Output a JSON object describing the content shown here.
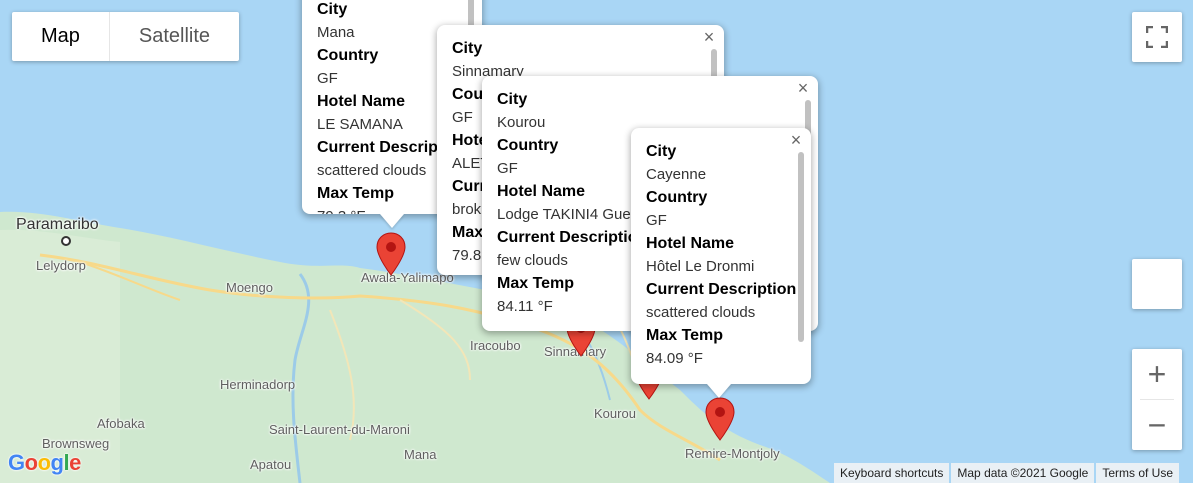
{
  "map_type": {
    "map_label": "Map",
    "satellite_label": "Satellite",
    "selected": "Map"
  },
  "places": [
    {
      "name": "Paramaribo",
      "big": true
    },
    {
      "name": "Lelydorp"
    },
    {
      "name": "Moengo"
    },
    {
      "name": "Awala-Yalimapo"
    },
    {
      "name": "Iracoubo"
    },
    {
      "name": "Sinnamary"
    },
    {
      "name": "Herminadorp"
    },
    {
      "name": "Afobaka"
    },
    {
      "name": "Brownsweg"
    },
    {
      "name": "Saint-Laurent-du-Maroni"
    },
    {
      "name": "Mana"
    },
    {
      "name": "Apatou"
    },
    {
      "name": "Kourou"
    },
    {
      "name": "Remire-Montjoly"
    }
  ],
  "info_windows": [
    {
      "city": "Mana",
      "country": "GF",
      "hotel": "LE SAMANA",
      "description": "scattered clouds",
      "max_temp": "79.3 °F"
    },
    {
      "city": "Sinnamary",
      "country": "GF",
      "hotel": "ALET",
      "description": "brok",
      "max_temp": "79.8"
    },
    {
      "city": "Kourou",
      "country": "GF",
      "hotel": "Lodge TAKINI4 Gue",
      "description": "few clouds",
      "max_temp": "84.11 °F"
    },
    {
      "city": "Cayenne",
      "country": "GF",
      "hotel": "Hôtel Le Dronmi",
      "description": "scattered clouds",
      "max_temp": "84.09 °F"
    }
  ],
  "labels": {
    "city": "City",
    "country": "Country",
    "hotel": "Hotel Name",
    "description": "Current Description",
    "max_temp": "Max Temp"
  },
  "truncated_labels": {
    "country": "Cou",
    "hotel": "Hote",
    "description": "Curr",
    "max_temp": "Max"
  },
  "controls": {
    "fullscreen_icon": "fullscreen-icon",
    "zoom_in": "+",
    "zoom_out": "−",
    "close": "×"
  },
  "google_logo": "Google",
  "footer": {
    "shortcuts": "Keyboard shortcuts",
    "map_data": "Map data ©2021 Google",
    "terms": "Terms of Use"
  },
  "colors": {
    "water": "#a9d6f5",
    "land": "#cfe8cf",
    "road": "#f7d98a",
    "marker": "#ea4335"
  }
}
